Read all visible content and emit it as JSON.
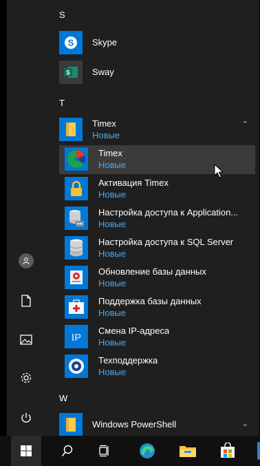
{
  "sections": {
    "s": "S",
    "t": "T",
    "w": "W"
  },
  "apps": {
    "skype": "Skype",
    "sway": "Sway",
    "windows_powershell": "Windows PowerShell"
  },
  "folder": {
    "name": "Timex",
    "badge": "Новые",
    "expanded_icon": "chevron-up-icon"
  },
  "folder_items": [
    {
      "label": "Timex",
      "badge": "Новые",
      "icon": "timex-pie-icon"
    },
    {
      "label": "Активация Timex",
      "badge": "Новые",
      "icon": "lock-icon"
    },
    {
      "label": "Настройка доступа к Application...",
      "badge": "Новые",
      "icon": "database-server-icon"
    },
    {
      "label": "Настройка доступа к SQL Server",
      "badge": "Новые",
      "icon": "database-icon"
    },
    {
      "label": "Обновление базы данных",
      "badge": "Новые",
      "icon": "db-update-icon"
    },
    {
      "label": "Поддержка базы данных",
      "badge": "Новые",
      "icon": "first-aid-kit-icon"
    },
    {
      "label": "Смена IP-адреса",
      "badge": "Новые",
      "icon": "ip-icon"
    },
    {
      "label": "Техподдержка",
      "badge": "Новые",
      "icon": "support-icon"
    }
  ],
  "colors": {
    "tile_blue": "#0078d7",
    "badge_text": "#4ea8e8",
    "highlight": "#3b3b3b",
    "folder_yellow": "#f7cd4f"
  }
}
